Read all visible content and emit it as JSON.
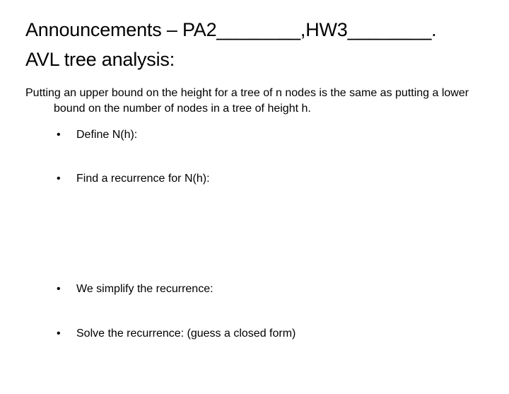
{
  "heading": "Announcements – PA2________,HW3________.",
  "subheading": "AVL tree analysis:",
  "intro": "Putting an upper bound on the height for a tree of n nodes is the same as putting a lower bound on the number of nodes in a tree of height h.",
  "bullets": [
    "Define N(h):",
    "Find a recurrence for N(h):",
    "We simplify the recurrence:",
    "Solve the recurrence:  (guess a closed form)"
  ]
}
